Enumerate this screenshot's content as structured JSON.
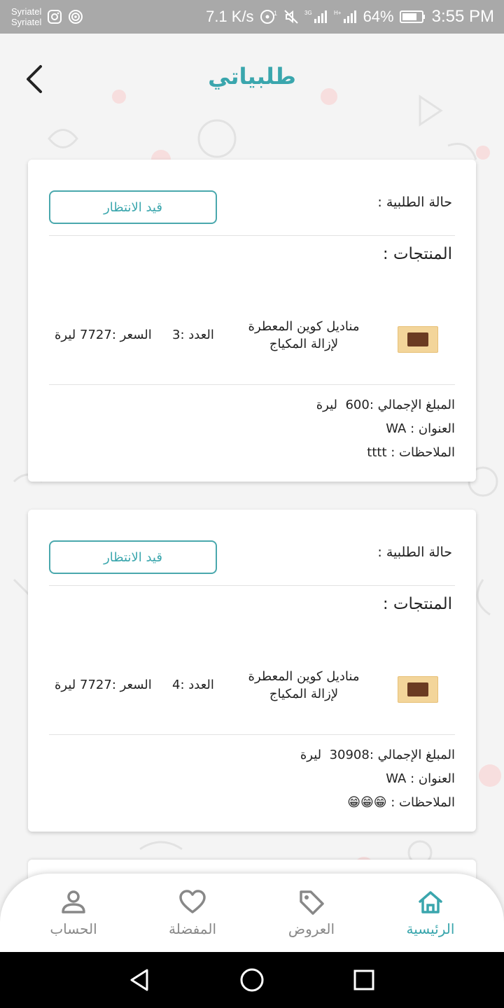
{
  "status_bar": {
    "carrier_1": "Syriatel",
    "carrier_2": "Syriatel",
    "speed": "7.1 K/s",
    "battery": "64%",
    "time": "3:55 PM"
  },
  "header": {
    "title": "طلبياتي"
  },
  "orders": [
    {
      "status_label": "حالة الطلبية :",
      "status_value": "قيد الانتظار",
      "products_title": "المنتجات :",
      "product_name": "مناديل كوين المعطرة لإزالة المكياج",
      "product_qty": "العدد :3",
      "product_price": "السعر :7727 ليرة",
      "total_label": "المبلغ الإجمالي :",
      "total_value": "600",
      "currency": "ليرة",
      "address_label": "العنوان :",
      "address_value": "WA",
      "notes_label": "الملاحظات :",
      "notes_value": "tttt"
    },
    {
      "status_label": "حالة الطلبية :",
      "status_value": "قيد الانتظار",
      "products_title": "المنتجات :",
      "product_name": "مناديل كوين المعطرة لإزالة المكياج",
      "product_qty": "العدد :4",
      "product_price": "السعر :7727 ليرة",
      "total_label": "المبلغ الإجمالي :",
      "total_value": "30908",
      "currency": "ليرة",
      "address_label": "العنوان :",
      "address_value": "WA",
      "notes_label": "الملاحظات :",
      "notes_value": "😁😁😁"
    }
  ],
  "bottom_nav": {
    "items": [
      {
        "label": "الرئيسية",
        "icon": "home-icon",
        "active": true
      },
      {
        "label": "العروض",
        "icon": "tag-icon",
        "active": false
      },
      {
        "label": "المفضلة",
        "icon": "heart-icon",
        "active": false
      },
      {
        "label": "الحساب",
        "icon": "user-icon",
        "active": false
      }
    ]
  },
  "colors": {
    "accent": "#3aa6ad",
    "inactive": "#888888",
    "status_bar": "#a9a9a9"
  }
}
